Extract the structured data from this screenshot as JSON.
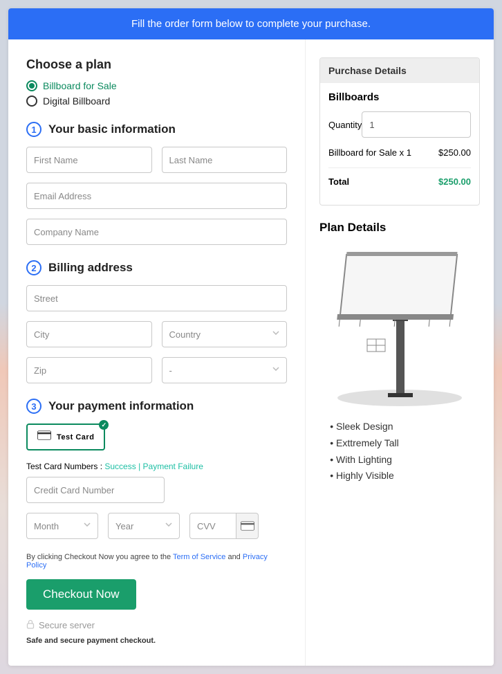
{
  "banner": "Fill the order form below to complete your purchase.",
  "plan": {
    "title": "Choose a plan",
    "options": [
      "Billboard for Sale",
      "Digital Billboard"
    ],
    "selected_index": 0
  },
  "step1": {
    "num": "1",
    "title": "Your basic information",
    "fields": {
      "first_name": "First Name",
      "last_name": "Last Name",
      "email": "Email Address",
      "company": "Company Name"
    }
  },
  "step2": {
    "num": "2",
    "title": "Billing address",
    "fields": {
      "street": "Street",
      "city": "City",
      "country": "Country",
      "zip": "Zip",
      "state": "-"
    }
  },
  "step3": {
    "num": "3",
    "title": "Your payment information",
    "card_option": "Test  Card",
    "test_label": "Test Card Numbers : ",
    "test_success": "Success",
    "test_failure": "Payment Failure",
    "cc_placeholder": "Credit Card Number",
    "month": "Month",
    "year": "Year",
    "cvv": "CVV"
  },
  "terms": {
    "prefix": "By clicking Checkout Now you agree to the ",
    "tos": "Term of Service",
    "and": " and ",
    "privacy": "Privacy Policy"
  },
  "checkout_label": "Checkout Now",
  "secure_label": "Secure server",
  "safe_note": "Safe and secure payment checkout.",
  "purchase": {
    "title": "Purchase Details",
    "subtitle": "Billboards",
    "qty_label": "Quantity",
    "qty_value": "1",
    "line_item_label": "Billboard for Sale x 1",
    "line_item_price": "$250.00",
    "total_label": "Total",
    "total_value": "$250.00"
  },
  "details": {
    "title": "Plan Details",
    "bullets": [
      "Sleek Design",
      "Exttremely Tall",
      "With Lighting",
      "Highly Visible"
    ]
  }
}
